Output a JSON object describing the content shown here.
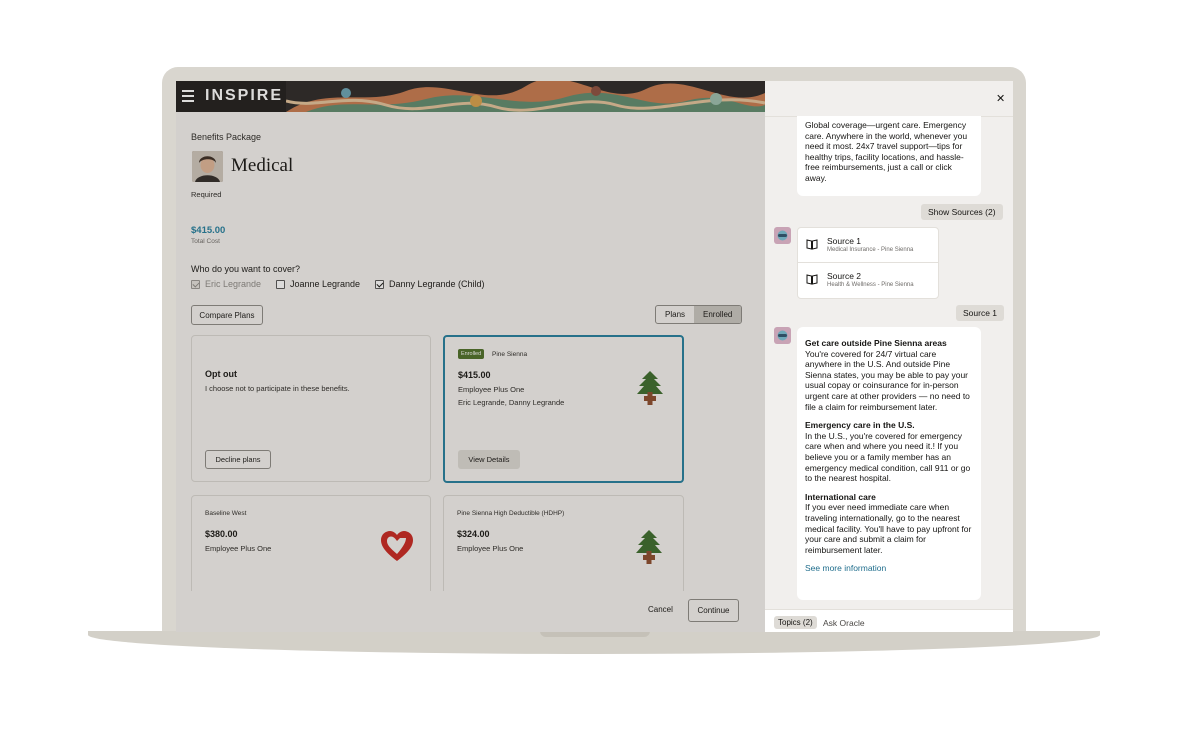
{
  "app": {
    "brand": "INSPIRE",
    "breadcrumb": "Benefits Package",
    "title": "Medical",
    "required": "Required",
    "total_cost": "$415.00",
    "total_cost_label": "Total Cost",
    "cover_question": "Who do you want to cover?",
    "cover_options": [
      {
        "label": "Eric Legrande",
        "checked": true,
        "disabled": true
      },
      {
        "label": "Joanne Legrande",
        "checked": false,
        "disabled": false
      },
      {
        "label": "Danny Legrande (Child)",
        "checked": true,
        "disabled": false
      }
    ],
    "compare_plans": "Compare Plans",
    "segments": [
      "Plans",
      "Enrolled"
    ],
    "cards": {
      "optout": {
        "title": "Opt out",
        "desc": "I choose not to participate in these benefits.",
        "button": "Decline plans"
      },
      "enrolled": {
        "badge": "Enrolled",
        "provider": "Pine Sienna",
        "price": "$415.00",
        "tier": "Employee Plus One",
        "members": "Eric Legrande, Danny Legrande",
        "button": "View Details"
      },
      "baseline": {
        "provider": "Baseline West",
        "price": "$380.00",
        "tier": "Employee Plus One"
      },
      "hdhp": {
        "provider": "Pine Sienna High Deductible (HDHP)",
        "price": "$324.00",
        "tier": "Employee Plus One"
      }
    },
    "cancel": "Cancel",
    "continue": "Continue",
    "colors": {
      "accent": "#227e9e",
      "badge": "#4c6e26",
      "pine": "#3a6b2a",
      "heart": "#c8251f"
    }
  },
  "panel": {
    "close": "✕",
    "intro_text": "Global coverage—urgent care. Emergency care. Anywhere in the world, whenever you need it most. 24x7 travel support—tips for healthy trips, facility locations, and hassle-free reimbursements, just a call or click away.",
    "show_sources": "Show Sources (2)",
    "sources": [
      {
        "name": "Source 1",
        "meta": "Medical Insurance - Pine Sienna"
      },
      {
        "name": "Source 2",
        "meta": "Health & Wellness - Pine Sienna"
      }
    ],
    "source1_chip": "Source 1",
    "answer": [
      {
        "heading": "Get care outside Pine Sienna areas",
        "body": "You're covered for 24/7 virtual care anywhere in the U.S. And outside Pine Sienna states, you may be able to pay your usual copay or coinsurance for in-person urgent care at other providers — no need to file a claim for reimbursement later."
      },
      {
        "heading": "Emergency care in the U.S.",
        "body": "In the U.S., you're covered for emergency care when and where you need it.! If you believe you or a family member has an emergency medical condition, call 911 or go to the nearest hospital."
      },
      {
        "heading": "International care",
        "body": "If you ever need immediate care when traveling internationally, go to the nearest medical facility. You'll have to pay upfront for your care and submit a claim for reimbursement later."
      }
    ],
    "see_more": "See more information",
    "topics": "Topics (2)",
    "ask_placeholder": "Ask Oracle"
  }
}
